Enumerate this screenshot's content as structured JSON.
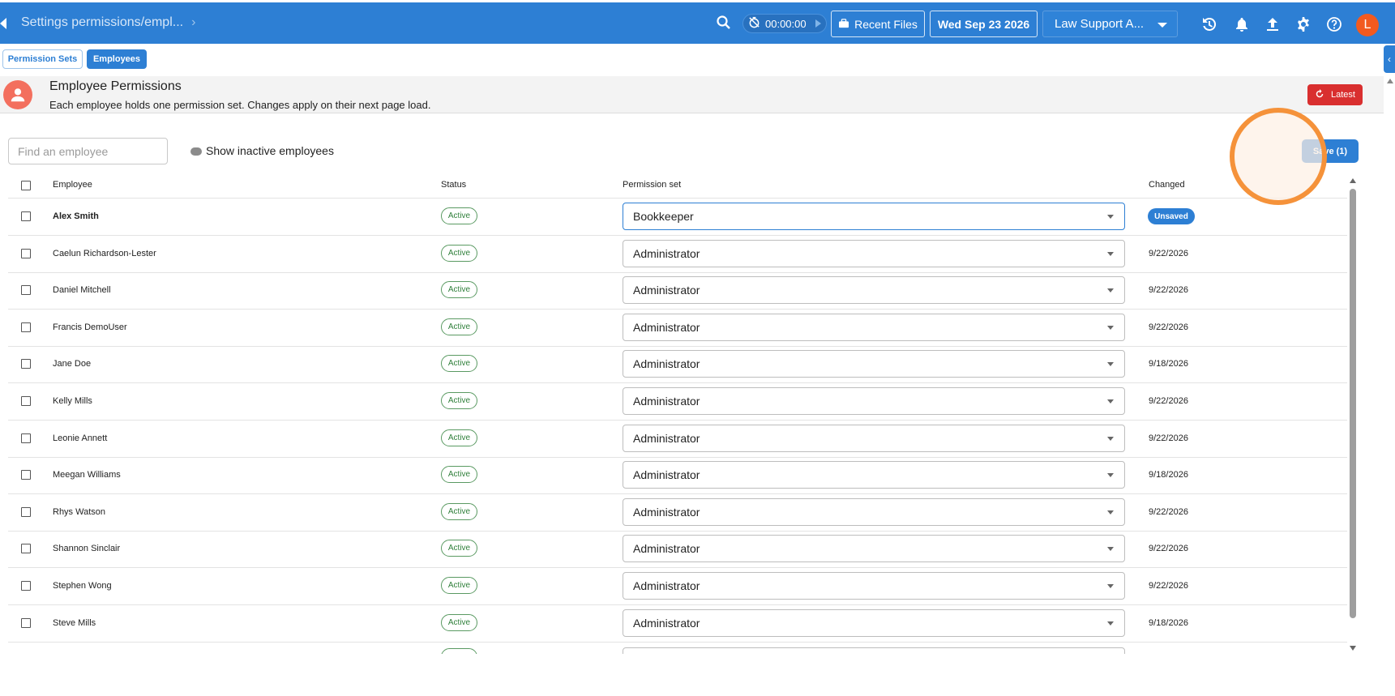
{
  "topbar": {
    "breadcrumb": "Settings permissions/empl...",
    "timer": "00:00:00",
    "recent_files": "Recent Files",
    "date": "Wed Sep 23 2026",
    "org_select": "Law Support A...",
    "avatar_initial": "L",
    "icons": [
      "home-icon",
      "search-icon",
      "timer-off-icon",
      "briefcase-icon",
      "history-icon",
      "bell-icon",
      "upload-icon",
      "gear-icon",
      "help-icon"
    ]
  },
  "tabs": [
    {
      "label": "Permission Sets",
      "active": false
    },
    {
      "label": "Employees",
      "active": true
    }
  ],
  "header": {
    "title": "Employee Permissions",
    "subtitle": "Each employee holds one permission set. Changes apply on their next page load.",
    "latest_label": "Latest"
  },
  "toolbar": {
    "search_placeholder": "Find an employee",
    "show_inactive_label": "Show inactive employees",
    "save_label": "Save (1)"
  },
  "table": {
    "columns": [
      "Employee",
      "Status",
      "Permission set",
      "Changed"
    ],
    "rows": [
      {
        "name": "Alex Smith",
        "status": "Active",
        "permission_set": "Bookkeeper",
        "changed": "Unsaved"
      },
      {
        "name": "Caelun Richardson-Lester",
        "status": "Active",
        "permission_set": "Administrator",
        "changed": "9/22/2026"
      },
      {
        "name": "Daniel Mitchell",
        "status": "Active",
        "permission_set": "Administrator",
        "changed": "9/22/2026"
      },
      {
        "name": "Francis DemoUser",
        "status": "Active",
        "permission_set": "Administrator",
        "changed": "9/22/2026"
      },
      {
        "name": "Jane Doe",
        "status": "Active",
        "permission_set": "Administrator",
        "changed": "9/18/2026"
      },
      {
        "name": "Kelly Mills",
        "status": "Active",
        "permission_set": "Administrator",
        "changed": "9/22/2026"
      },
      {
        "name": "Leonie Annett",
        "status": "Active",
        "permission_set": "Administrator",
        "changed": "9/22/2026"
      },
      {
        "name": "Meegan Williams",
        "status": "Active",
        "permission_set": "Administrator",
        "changed": "9/18/2026"
      },
      {
        "name": "Rhys Watson",
        "status": "Active",
        "permission_set": "Administrator",
        "changed": "9/22/2026"
      },
      {
        "name": "Shannon Sinclair",
        "status": "Active",
        "permission_set": "Administrator",
        "changed": "9/22/2026"
      },
      {
        "name": "Stephen Wong",
        "status": "Active",
        "permission_set": "Administrator",
        "changed": "9/22/2026"
      },
      {
        "name": "Steve Mills",
        "status": "Active",
        "permission_set": "Administrator",
        "changed": "9/18/2026"
      }
    ]
  },
  "colors": {
    "primary": "#2d7fd4",
    "danger": "#d92f2f",
    "success": "#2f7f3a",
    "avatar": "#f25a1f",
    "cursor_ring": "#f5923a"
  }
}
